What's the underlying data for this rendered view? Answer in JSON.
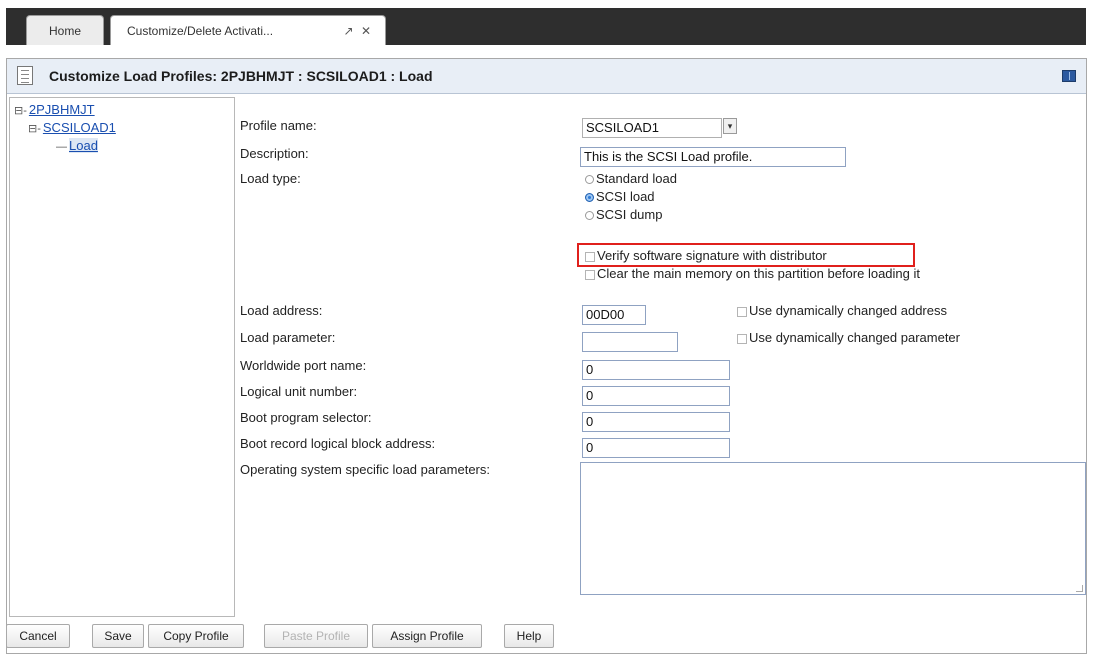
{
  "tabs": {
    "home": "Home",
    "active": "Customize/Delete Activati...",
    "popout_icon": "popout-icon",
    "close_icon": "close-icon"
  },
  "window": {
    "title": "Customize Load Profiles: 2PJBHMJT : SCSILOAD1 : Load"
  },
  "tree": {
    "root": "2PJBHMJT",
    "profile": "SCSILOAD1",
    "leaf": "Load",
    "expand_glyph": "⊟-",
    "leaf_glyph": "—"
  },
  "form": {
    "profile_name_label": "Profile name:",
    "profile_name_value": "SCSILOAD1",
    "description_label": "Description:",
    "description_value": "This is the SCSI Load profile.",
    "load_type_label": "Load type:",
    "load_types": [
      {
        "label": "Standard load",
        "selected": false
      },
      {
        "label": "SCSI load",
        "selected": true
      },
      {
        "label": "SCSI dump",
        "selected": false
      }
    ],
    "verify_signature": "Verify software signature with distributor",
    "clear_memory": "Clear the main memory on this partition before loading it",
    "load_address_label": "Load address:",
    "load_address_value": "00D00",
    "use_dynamic_address": "Use dynamically changed address",
    "load_parameter_label": "Load parameter:",
    "load_parameter_value": "",
    "use_dynamic_parameter": "Use dynamically changed parameter",
    "wwpn_label": "Worldwide port name:",
    "wwpn_value": "0",
    "lun_label": "Logical unit number:",
    "lun_value": "0",
    "boot_program_label": "Boot program selector:",
    "boot_program_value": "0",
    "boot_record_label": "Boot record logical block address:",
    "boot_record_value": "0",
    "os_params_label": "Operating system specific load parameters:",
    "os_params_value": ""
  },
  "buttons": {
    "cancel": "Cancel",
    "save": "Save",
    "copy_profile": "Copy Profile",
    "paste_profile": "Paste Profile",
    "assign_profile": "Assign Profile",
    "help": "Help"
  },
  "colors": {
    "highlight_border": "#e0201c",
    "selected_radio": "#2f7ad6",
    "link": "#1a4fb0"
  }
}
